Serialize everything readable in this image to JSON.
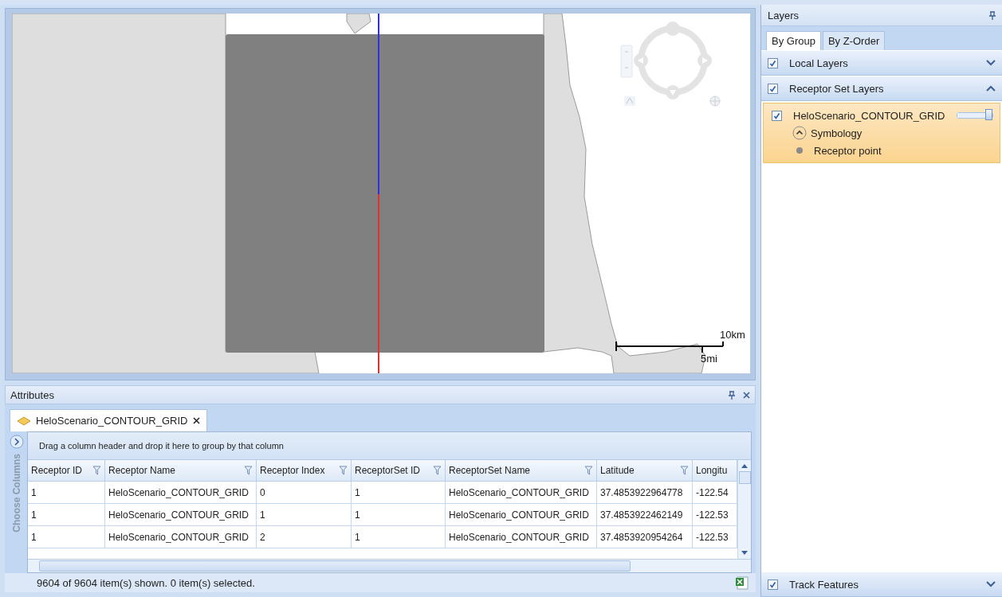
{
  "map": {
    "scale_bar": {
      "km_label": "10km",
      "mi_label": "5mi"
    }
  },
  "attributes": {
    "title": "Attributes",
    "tab": {
      "label": "HeloScenario_CONTOUR_GRID"
    },
    "side_label": "Choose Columns",
    "group_hint": "Drag a column header and drop it here to group by that column",
    "columns": [
      "Receptor ID",
      "Receptor Name",
      "Receptor Index",
      "ReceptorSet ID",
      "ReceptorSet Name",
      "Latitude",
      "Longitu"
    ],
    "rows": [
      [
        "1",
        "HeloScenario_CONTOUR_GRID",
        "0",
        "1",
        "HeloScenario_CONTOUR_GRID",
        "37.4853922964778",
        "-122.54"
      ],
      [
        "1",
        "HeloScenario_CONTOUR_GRID",
        "1",
        "1",
        "HeloScenario_CONTOUR_GRID",
        "37.4853922462149",
        "-122.53"
      ],
      [
        "1",
        "HeloScenario_CONTOUR_GRID",
        "2",
        "1",
        "HeloScenario_CONTOUR_GRID",
        "37.4853920954264",
        "-122.53"
      ]
    ],
    "status": "9604 of 9604 item(s) shown. 0 item(s) selected."
  },
  "layers": {
    "title": "Layers",
    "tabs": [
      {
        "label": "By Group",
        "selected": true
      },
      {
        "label": "By Z-Order",
        "selected": false
      }
    ],
    "groups": [
      {
        "label": "Local Layers",
        "checked": true,
        "expanded": false
      },
      {
        "label": "Receptor Set Layers",
        "checked": true,
        "expanded": true,
        "children": [
          {
            "label": "HeloScenario_CONTOUR_GRID",
            "checked": true,
            "selected": true,
            "level": 1.0,
            "children": [
              {
                "kind": "symbology",
                "label": "Symbology"
              },
              {
                "kind": "point",
                "label": "Receptor point"
              }
            ]
          }
        ]
      }
    ],
    "footer_group": {
      "label": "Track Features",
      "checked": true,
      "expanded": false
    }
  }
}
